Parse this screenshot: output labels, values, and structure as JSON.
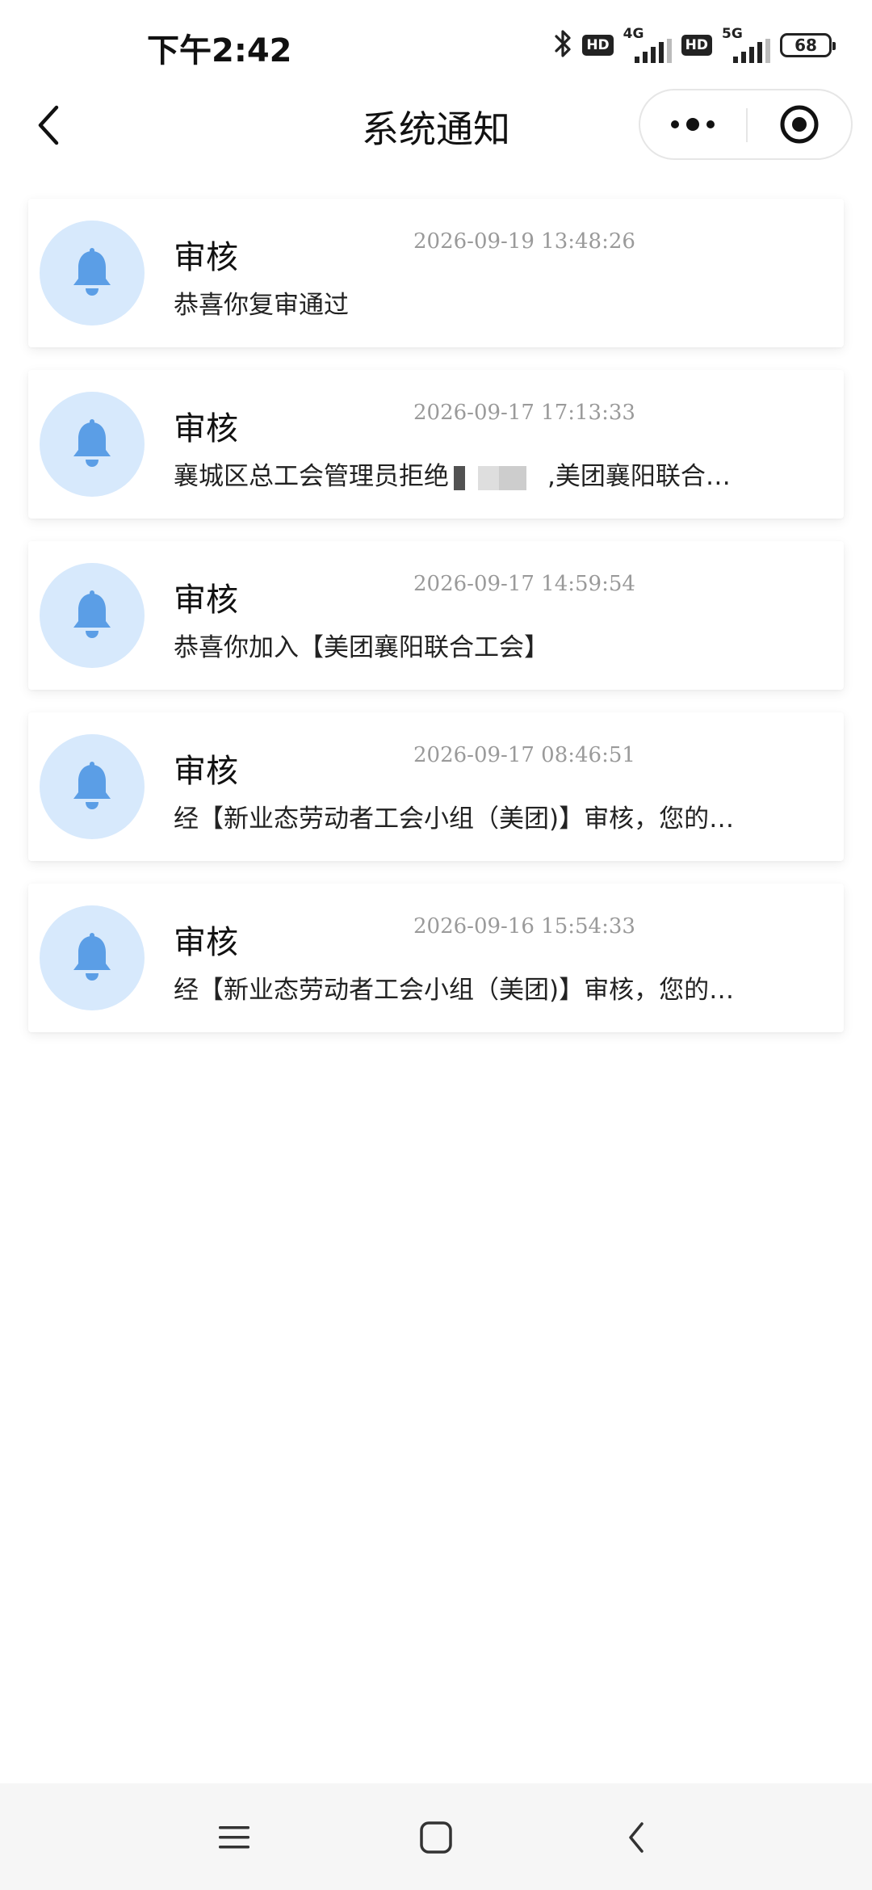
{
  "status_bar": {
    "time": "下午2:42",
    "hd1": "HD",
    "net1": "4G",
    "hd2": "HD",
    "net2": "5G",
    "battery": "68",
    "icons": [
      "bluetooth-icon",
      "signal-icon",
      "battery-icon"
    ]
  },
  "nav": {
    "title": "系统通知",
    "back_icon": "chevron-left-icon",
    "more_icon": "more-dots-icon",
    "close_icon": "target-close-icon"
  },
  "notifications": [
    {
      "title": "审核",
      "time": "2026-09-19 13:48:26",
      "content": "恭喜你复审通过",
      "icon": "bell-icon"
    },
    {
      "title": "审核",
      "time": "2026-09-17 17:13:33",
      "content_prefix": "襄城区总工会管理员拒绝",
      "content_suffix": ",美团襄阳联合…",
      "icon": "bell-icon"
    },
    {
      "title": "审核",
      "time": "2026-09-17 14:59:54",
      "content": "恭喜你加入【美团襄阳联合工会】",
      "icon": "bell-icon"
    },
    {
      "title": "审核",
      "time": "2026-09-17 08:46:51",
      "content": "经【新业态劳动者工会小组（美团)】审核，您的…",
      "icon": "bell-icon"
    },
    {
      "title": "审核",
      "time": "2026-09-16 15:54:33",
      "content": "经【新业态劳动者工会小组（美团)】审核，您的…",
      "icon": "bell-icon"
    }
  ],
  "colors": {
    "accent_blue": "#5b9ee6",
    "avatar_bg": "#d7e9fc",
    "time_gray": "#9a9a9a"
  },
  "bottom_nav": {
    "icons": [
      "menu-icon",
      "home-square-icon",
      "back-icon"
    ]
  }
}
